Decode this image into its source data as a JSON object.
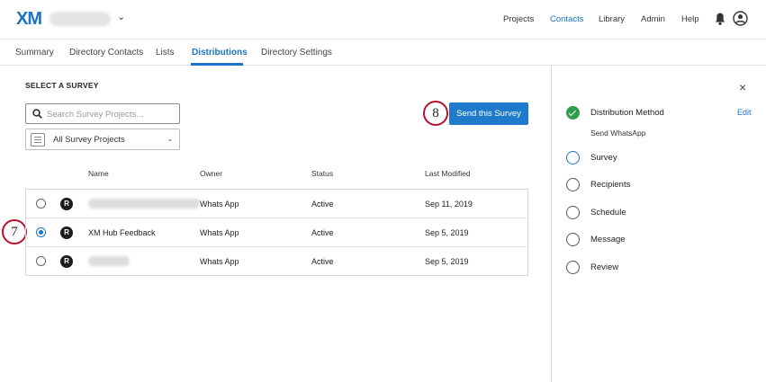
{
  "app": {
    "logo": "XM",
    "brand_chevron": "⌄"
  },
  "nav": {
    "projects": "Projects",
    "contacts": "Contacts",
    "library": "Library",
    "admin": "Admin",
    "help": "Help"
  },
  "tabs": {
    "summary": "Summary",
    "directory_contacts": "Directory Contacts",
    "lists": "Lists",
    "distributions": "Distributions",
    "directory_settings": "Directory Settings"
  },
  "main": {
    "section_title": "SELECT A SURVEY",
    "search_placeholder": "Search Survey Projects...",
    "filter_label": "All Survey Projects",
    "send_button": "Send this Survey",
    "callout_select": "7",
    "callout_send": "8"
  },
  "table": {
    "headers": {
      "name": "Name",
      "owner": "Owner",
      "status": "Status",
      "last_modified": "Last Modified"
    },
    "rows": [
      {
        "name": "",
        "owner": "Whats App",
        "status": "Active",
        "last_modified": "Sep 11, 2019",
        "selected": false
      },
      {
        "name": "XM Hub Feedback",
        "owner": "Whats App",
        "status": "Active",
        "last_modified": "Sep 5, 2019",
        "selected": true
      },
      {
        "name": "",
        "owner": "Whats App",
        "status": "Active",
        "last_modified": "Sep 5, 2019",
        "selected": false
      }
    ]
  },
  "panel": {
    "close": "×",
    "edit": "Edit",
    "steps": [
      {
        "label": "Distribution Method",
        "sub": "Send WhatsApp",
        "state": "done"
      },
      {
        "label": "Survey",
        "state": "current"
      },
      {
        "label": "Recipients",
        "state": "todo"
      },
      {
        "label": "Schedule",
        "state": "todo"
      },
      {
        "label": "Message",
        "state": "todo"
      },
      {
        "label": "Review",
        "state": "todo"
      }
    ]
  },
  "colors": {
    "accent": "#1a73c8",
    "button": "#1f7acb",
    "success": "#2e9d4b",
    "callout_ring": "#b5122d"
  }
}
